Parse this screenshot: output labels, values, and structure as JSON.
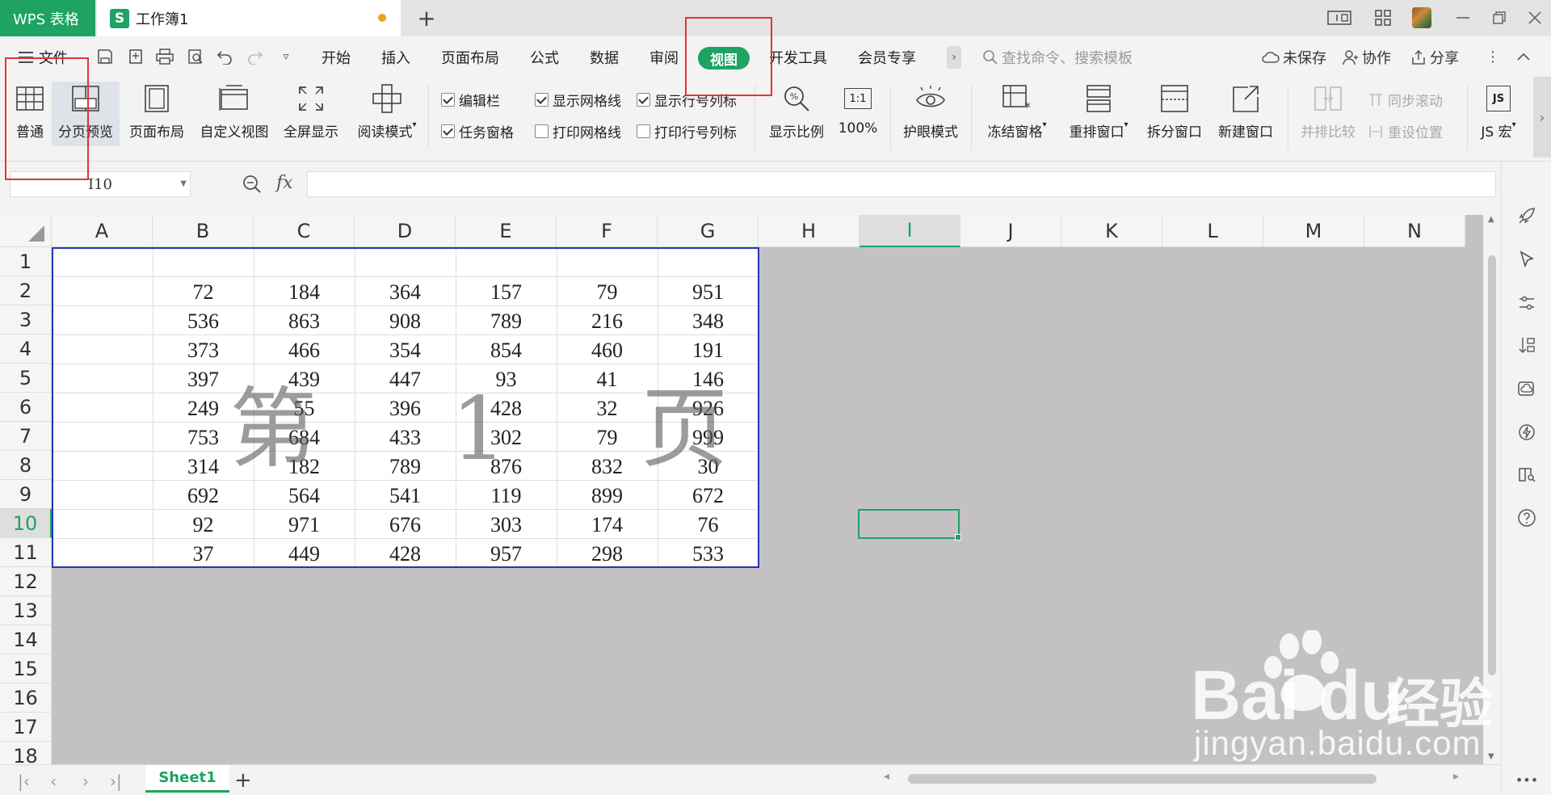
{
  "app": {
    "name": "WPS 表格",
    "doc_title": "工作簿1",
    "sheet_logo": "S"
  },
  "menu": {
    "file": "文件",
    "tabs": [
      "开始",
      "插入",
      "页面布局",
      "公式",
      "数据",
      "审阅",
      "视图",
      "开发工具",
      "会员专享"
    ],
    "search_placeholder": "查找命令、搜索模板",
    "unsaved": "未保存",
    "collab": "协作",
    "share": "分享"
  },
  "ribbon": {
    "normal": "普通",
    "page_break_preview": "分页预览",
    "page_layout": "页面布局",
    "custom_view": "自定义视图",
    "fullscreen": "全屏显示",
    "reading_mode": "阅读模式",
    "checks": {
      "edit_bar": {
        "label": "编辑栏",
        "checked": true
      },
      "task_pane": {
        "label": "任务窗格",
        "checked": true
      },
      "show_gridlines": {
        "label": "显示网格线",
        "checked": true
      },
      "print_gridlines": {
        "label": "打印网格线",
        "checked": false
      },
      "show_headings": {
        "label": "显示行号列标",
        "checked": true
      },
      "print_headings": {
        "label": "打印行号列标",
        "checked": false
      }
    },
    "zoom": "显示比例",
    "zoom_100": "100%",
    "zoom_100_icon": "1:1",
    "eye_care": "护眼模式",
    "freeze": "冻结窗格",
    "rearrange": "重排窗口",
    "split": "拆分窗口",
    "new_window": "新建窗口",
    "compare": "并排比较",
    "sync_scroll": "同步滚动",
    "reset_pos": "重设位置",
    "js_macro": "JS 宏",
    "js_icon": "JS"
  },
  "formula_bar": {
    "cell_ref": "I10",
    "fx": "fx",
    "value": ""
  },
  "grid": {
    "columns": [
      "A",
      "B",
      "C",
      "D",
      "E",
      "F",
      "G",
      "H",
      "I",
      "J",
      "K",
      "L",
      "M",
      "N"
    ],
    "selected_column": "I",
    "rows": [
      "1",
      "2",
      "3",
      "4",
      "5",
      "6",
      "7",
      "8",
      "9",
      "10",
      "11",
      "12",
      "13",
      "14",
      "15",
      "16",
      "17",
      "18"
    ],
    "selected_row": "10",
    "data": [
      [
        "",
        "",
        "",
        "",
        "",
        ""
      ],
      [
        "72",
        "184",
        "364",
        "157",
        "79",
        "951"
      ],
      [
        "536",
        "863",
        "908",
        "789",
        "216",
        "348"
      ],
      [
        "373",
        "466",
        "354",
        "854",
        "460",
        "191"
      ],
      [
        "397",
        "439",
        "447",
        "93",
        "41",
        "146"
      ],
      [
        "249",
        "55",
        "396",
        "428",
        "32",
        "926"
      ],
      [
        "753",
        "684",
        "433",
        "302",
        "79",
        "999"
      ],
      [
        "314",
        "182",
        "789",
        "876",
        "832",
        "30"
      ],
      [
        "692",
        "564",
        "541",
        "119",
        "899",
        "672"
      ],
      [
        "92",
        "971",
        "676",
        "303",
        "174",
        "76"
      ],
      [
        "37",
        "449",
        "428",
        "957",
        "298",
        "533"
      ]
    ],
    "page_watermark": "第 1 页"
  },
  "sheet_tabs": {
    "active": "Sheet1"
  },
  "watermark": {
    "brand": "Bai  du",
    "cn": "经验",
    "url": "jingyan.baidu.com"
  },
  "colors": {
    "accent": "#1ea362",
    "page_border": "#2236b8",
    "annotation": "#e53333",
    "outside_page": "#c3c1c4"
  }
}
